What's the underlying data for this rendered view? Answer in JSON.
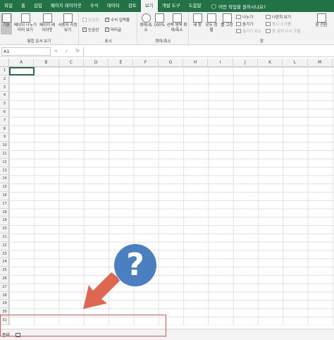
{
  "tabs": [
    "파일",
    "홈",
    "삽입",
    "페이지 레이아웃",
    "수식",
    "데이터",
    "검토",
    "보기",
    "개발 도구",
    "도움말"
  ],
  "active_tab": "보기",
  "tell_me": "어떤 작업을 원하시나요?",
  "ribbon": {
    "group_views": {
      "label": "통합 문서 보기",
      "normal": "기본",
      "page_break": "페이지 나누기 미리 보기",
      "page_layout": "페이지 레이아웃",
      "custom_views": "사용자 지정 보기"
    },
    "group_show": {
      "label": "표시",
      "ruler": "눈금자",
      "formula_bar": "수식 입력줄",
      "gridlines": "눈금선",
      "headings": "머리글"
    },
    "group_zoom": {
      "label": "확대/축소",
      "zoom": "확대/축소",
      "zoom100": "100%",
      "zoom_selection": "선택 영역 확대/축소"
    },
    "group_window": {
      "label": "창",
      "new_window": "새 창",
      "arrange_all": "모두 정렬",
      "freeze": "틀 고정",
      "split": "나누기",
      "hide": "숨기기",
      "unhide": "숨기기 취소",
      "side_by_side": "나란히 보기",
      "sync_scroll": "동시 스크롤",
      "reset_pos": "창 위치 다시 정렬",
      "switch": "창 전환"
    }
  },
  "formula_bar": {
    "name_box": "A1",
    "cancel": "×",
    "enter": "✓",
    "fx": "fx"
  },
  "columns": [
    "A",
    "B",
    "C",
    "D",
    "E",
    "F",
    "G",
    "H",
    "I",
    "J",
    "K",
    "L",
    "M"
  ],
  "rows": [
    "1",
    "2",
    "3",
    "4",
    "5",
    "6",
    "7",
    "8",
    "9",
    "10",
    "11",
    "12",
    "13",
    "14",
    "15",
    "16",
    "17",
    "18",
    "19",
    "20",
    "21",
    "22",
    "23",
    "24",
    "25",
    "26",
    "27",
    "28",
    "29",
    "30",
    "31"
  ],
  "status": {
    "ready": "준비",
    "macro_icon": "record-macro-icon"
  },
  "overlay": {
    "question": "?",
    "arrow_color": "#e0674f",
    "badge_color": "#4a7fc1",
    "box_color": "#e0584d"
  }
}
